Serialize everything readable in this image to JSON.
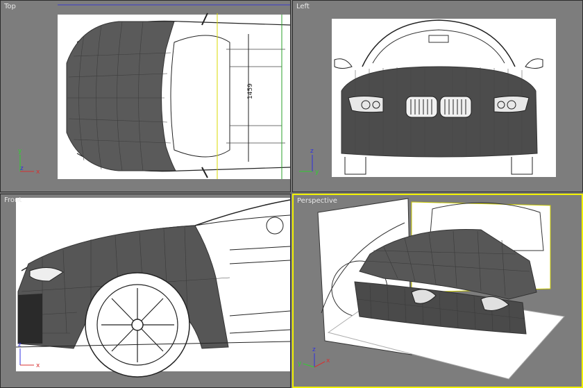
{
  "viewports": {
    "top": {
      "label": "Top",
      "dimension": "1459"
    },
    "left": {
      "label": "Left"
    },
    "front": {
      "label": "Front"
    },
    "perspective": {
      "label": "Perspective",
      "active": true
    }
  },
  "axes": {
    "x": "x",
    "y": "y",
    "z": "z"
  },
  "colors": {
    "viewport_bg": "#7d7d7d",
    "active_border": "#f2f200",
    "axis_x": "#d83030",
    "axis_y": "#30d030",
    "axis_z": "#3030e0",
    "mesh": "#4a4a4a"
  }
}
